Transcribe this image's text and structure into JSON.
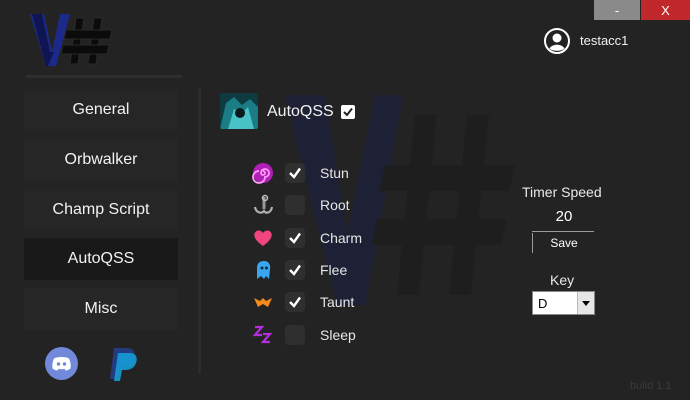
{
  "window": {
    "minimize_label": "-",
    "close_label": "X"
  },
  "user": {
    "name": "testacc1",
    "icon": "user-circle-icon"
  },
  "sidebar": {
    "items": [
      {
        "label": "General",
        "active": false
      },
      {
        "label": "Orbwalker",
        "active": false
      },
      {
        "label": "Champ Script",
        "active": false
      },
      {
        "label": "AutoQSS",
        "active": true
      },
      {
        "label": "Misc",
        "active": false
      }
    ],
    "links": [
      {
        "icon": "discord-icon"
      },
      {
        "icon": "paypal-icon"
      }
    ]
  },
  "autoqss": {
    "title": "AutoQSS",
    "enabled": true,
    "effects": [
      {
        "label": "Stun",
        "checked": true,
        "icon": "stun-spiral-icon"
      },
      {
        "label": "Root",
        "checked": false,
        "icon": "root-anchor-icon"
      },
      {
        "label": "Charm",
        "checked": true,
        "icon": "charm-heart-icon"
      },
      {
        "label": "Flee",
        "checked": true,
        "icon": "flee-ghost-icon"
      },
      {
        "label": "Taunt",
        "checked": true,
        "icon": "taunt-icon"
      },
      {
        "label": "Sleep",
        "checked": false,
        "icon": "sleep-zzz-icon"
      }
    ]
  },
  "timer": {
    "label": "Timer Speed",
    "value": "20",
    "save_label": "Save"
  },
  "key": {
    "label": "Key",
    "value": "D"
  },
  "footer": {
    "text": "build 1.1"
  },
  "colors": {
    "background": "#232323",
    "nav": "#262626",
    "nav_active": "#191919",
    "close": "#c0282b",
    "minimize": "#8a8a8a"
  }
}
